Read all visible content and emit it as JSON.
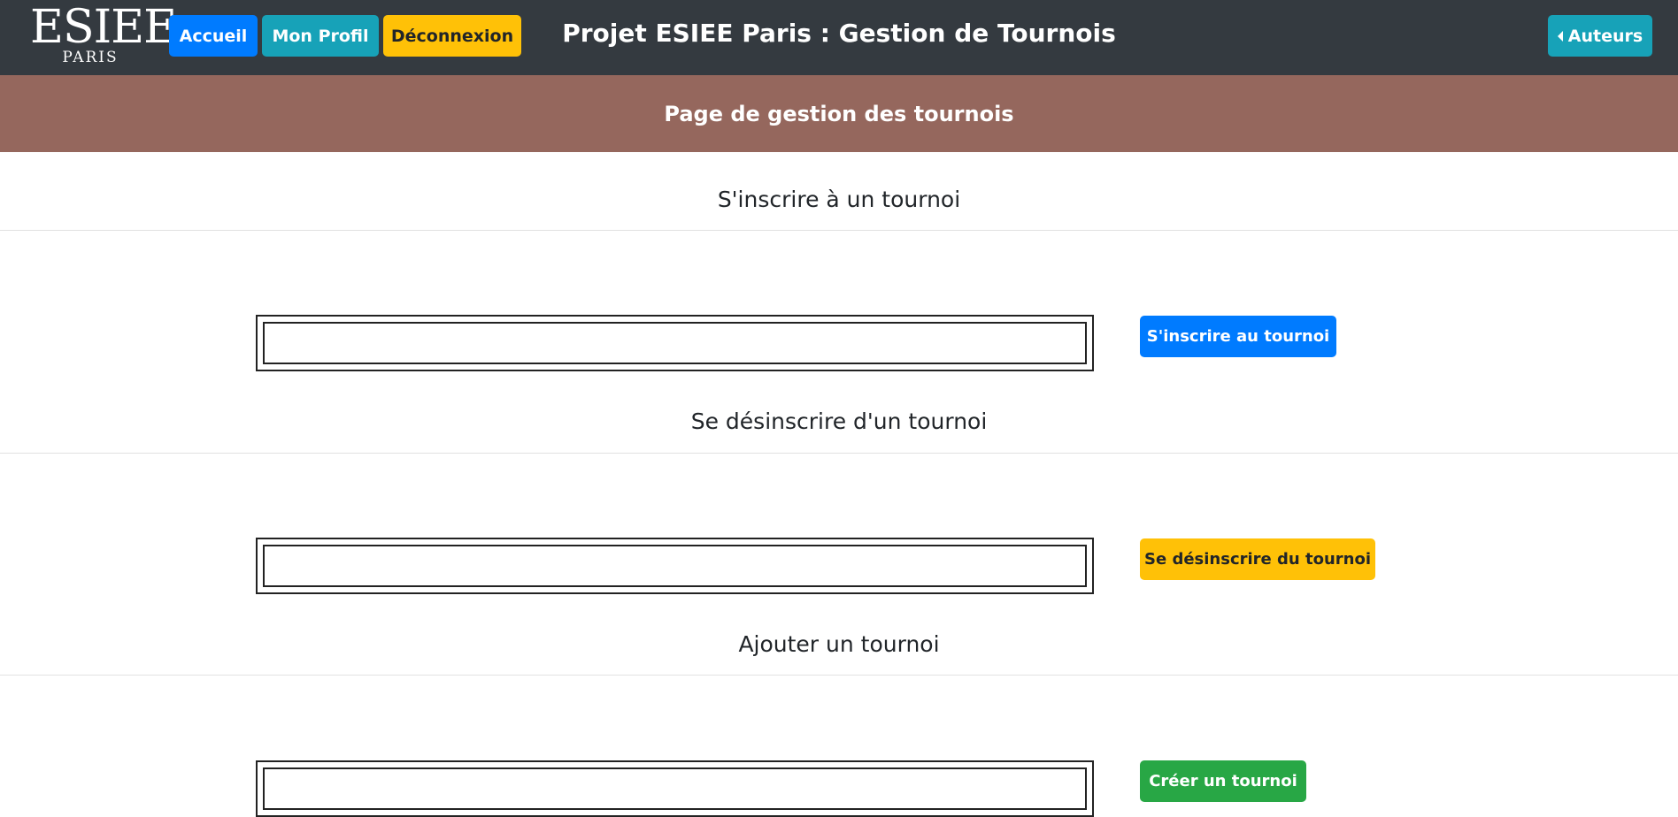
{
  "navbar": {
    "logo": {
      "main": "ESIEE",
      "sub": "PARIS"
    },
    "buttons": {
      "accueil": "Accueil",
      "profil": "Mon Profil",
      "deconnexion": "Déconnexion",
      "auteurs": "Auteurs"
    },
    "title": "Projet ESIEE Paris : Gestion de Tournois"
  },
  "banner": {
    "text": "Page de gestion des tournois"
  },
  "sections": [
    {
      "heading": "S'inscrire à un tournoi",
      "input_value": "",
      "button_label": "S'inscrire au tournoi"
    },
    {
      "heading": "Se désinscrire d'un tournoi",
      "input_value": "",
      "button_label": "Se désinscrire du tournoi"
    },
    {
      "heading": "Ajouter un tournoi",
      "input_value": "",
      "button_label": "Créer un tournoi"
    }
  ],
  "colors": {
    "navbar": "#343a40",
    "banner": "#95675d",
    "primary": "#007bff",
    "info": "#17a2b8",
    "warning": "#ffc107",
    "success": "#28a745"
  },
  "icons": {
    "auteurs_icon": "caret-left-icon"
  }
}
